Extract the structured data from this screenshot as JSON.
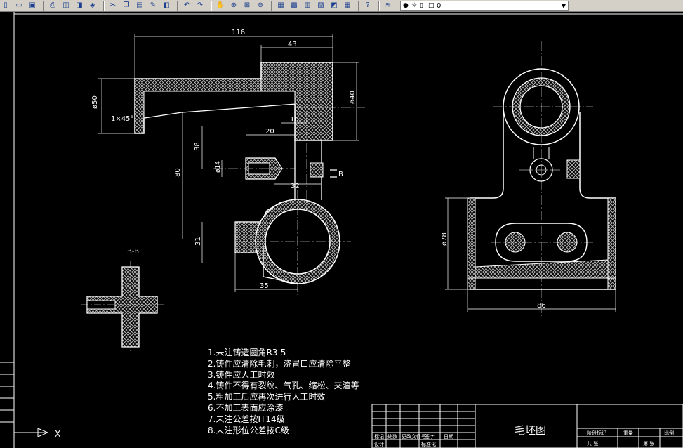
{
  "toolbar": {
    "icons": [
      "new-icon",
      "open-icon",
      "save-icon",
      "print-icon",
      "plot-preview-icon",
      "publish-icon",
      "3d-dwf-icon",
      "cut-icon",
      "copy-icon",
      "paste-icon",
      "match-properties-icon",
      "block-editor-icon",
      "undo-icon",
      "redo-icon",
      "pan-icon",
      "zoom-realtime-icon",
      "zoom-window-icon",
      "zoom-previous-icon",
      "properties-icon",
      "design-center-icon",
      "tool-palettes-icon",
      "sheet-set-icon",
      "markup-icon",
      "quickcalc-icon",
      "help-icon",
      "layer-manager-icon"
    ],
    "layer_value": "0"
  },
  "drawing": {
    "dimensions": {
      "d116": "116",
      "d43": "43",
      "d50_dia": "ø50",
      "d40_dia": "ø40",
      "d1x45": "1×45°",
      "d10": "10",
      "d20": "20",
      "d38": "38",
      "d80": "80",
      "d14_dia": "ø14",
      "d32": "32",
      "d31": "31",
      "d35": "35",
      "d78_dia": "ø78",
      "d86": "86",
      "b_mark": "B"
    },
    "section_label": "B-B",
    "ucs_x": "X",
    "notes": [
      "1.未注铸造圆角R3-5",
      "2.铸件应清除毛刺，浇冒口应清除平整",
      "3.铸件应人工时效",
      "4.铸件不得有裂纹、气孔、缩松、夹渣等",
      "5.粗加工后应再次进行人工时效",
      "6.不加工表面应涂漆",
      "7.未注公差按IT14级",
      "8.未注形位公差按C级"
    ],
    "title_block": {
      "title": "毛坯图",
      "row_labels": [
        "标记",
        "处数",
        "更改文件号",
        "签字",
        "日期"
      ],
      "row2_labels": [
        "设计",
        "标准化"
      ],
      "right_labels": [
        "阶段标记",
        "重量",
        "比例"
      ],
      "sheet_labels": [
        "共 张",
        "第 张"
      ]
    }
  }
}
